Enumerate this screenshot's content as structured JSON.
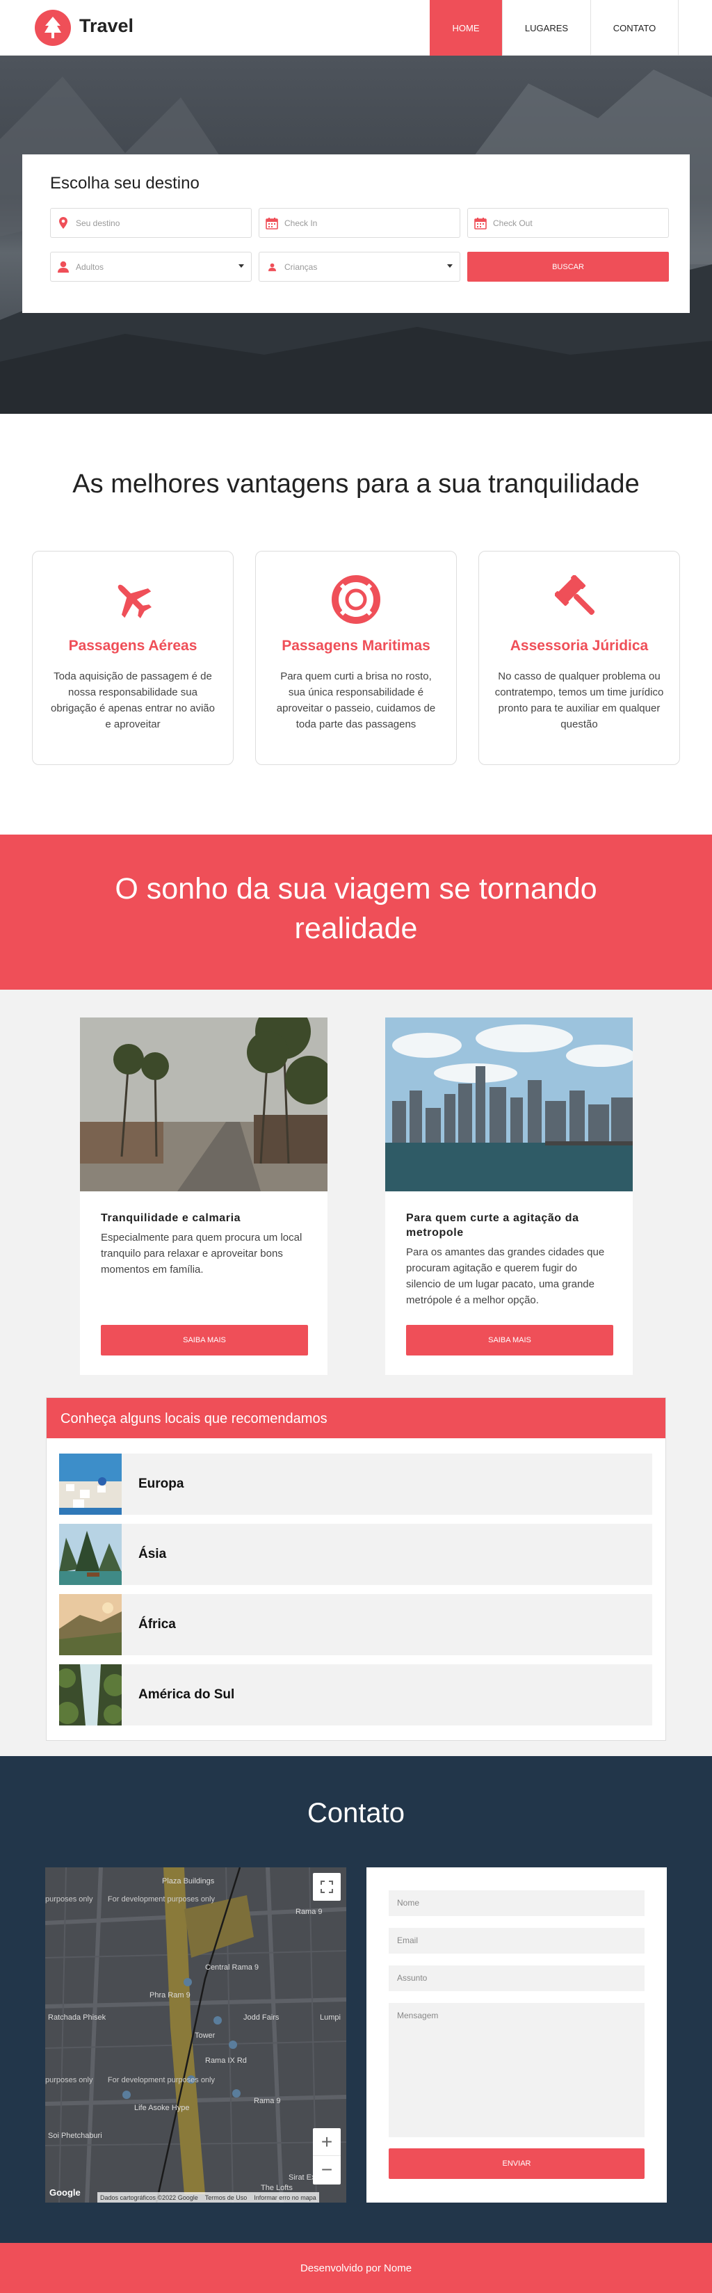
{
  "colors": {
    "accent": "#ef4f58",
    "dark": "#22364a",
    "light_gray": "#f2f2f2"
  },
  "header": {
    "brand": "Travel",
    "logo_icon": "tree-icon",
    "nav": [
      {
        "label": "HOME",
        "active": true
      },
      {
        "label": "LUGARES",
        "active": false
      },
      {
        "label": "CONTATO",
        "active": false
      }
    ]
  },
  "search": {
    "title": "Escolha seu destino",
    "destination_placeholder": "Seu destino",
    "checkin_placeholder": "Check In",
    "checkout_placeholder": "Check Out",
    "adults_value": "Adultos",
    "children_value": "Crianças",
    "button": "BUSCAR"
  },
  "advantages": {
    "title": "As melhores vantagens para a sua tranquilidade",
    "cards": [
      {
        "icon": "airplane-icon",
        "title": "Passagens Aéreas",
        "text": "Toda aquisição de passagem é de nossa responsabilidade sua obrigação é apenas entrar no avião e aproveitar"
      },
      {
        "icon": "lifebuoy-icon",
        "title": "Passagens Maritimas",
        "text": "Para quem curti a brisa no rosto, sua única responsabilidade é aproveitar o passeio, cuidamos de toda parte das passagens"
      },
      {
        "icon": "gavel-icon",
        "title": "Assessoria Júridica",
        "text": "No casso de qualquer problema ou contratempo, temos um time jurídico pronto para te auxiliar em qualquer questão"
      }
    ]
  },
  "banner": {
    "line1": "O sonho da sua viagem se tornando",
    "line2": "realidade"
  },
  "posts": [
    {
      "title": "Tranquilidade e calmaria",
      "text": "Especialmente para quem procura um local tranquilo para relaxar e aproveitar bons momentos em família.",
      "button": "SAIBA MAIS"
    },
    {
      "title": "Para quem curte a agitação da metropole",
      "text": "Para os amantes das grandes cidades que procuram agitação e querem fugir do silencio de um lugar pacato, uma grande metrópole é a melhor opção.",
      "button": "SAIBA MAIS"
    }
  ],
  "places": {
    "title": "Conheça alguns locais que recomendamos",
    "items": [
      "Europa",
      "Ásia",
      "África",
      "América do Sul"
    ]
  },
  "contact": {
    "title": "Contato",
    "name_placeholder": "Nome",
    "email_placeholder": "Email",
    "subject_placeholder": "Assunto",
    "message_placeholder": "Mensagem",
    "button": "ENVIAR",
    "map": {
      "labels": [
        "Plaza Buildings",
        "Rama 9",
        "Central Rama 9",
        "Phra Ram 9",
        "Jodd Fairs",
        "Lumpi",
        "Ratchada Phisek",
        "Tower",
        "Rama IX Rd",
        "Rama 9",
        "Life Asoke Hype",
        "Soi Phetchaburi",
        "Sirat Express",
        "The Lofts"
      ],
      "dev_text": "For development purposes only",
      "dev_text_short": "purposes only",
      "google": "Google",
      "footer_items": [
        "Dados cartográficos ©2022 Google",
        "Termos de Uso",
        "Informar erro no mapa"
      ]
    }
  },
  "footer": {
    "text": "Desenvolvido por Nome"
  }
}
